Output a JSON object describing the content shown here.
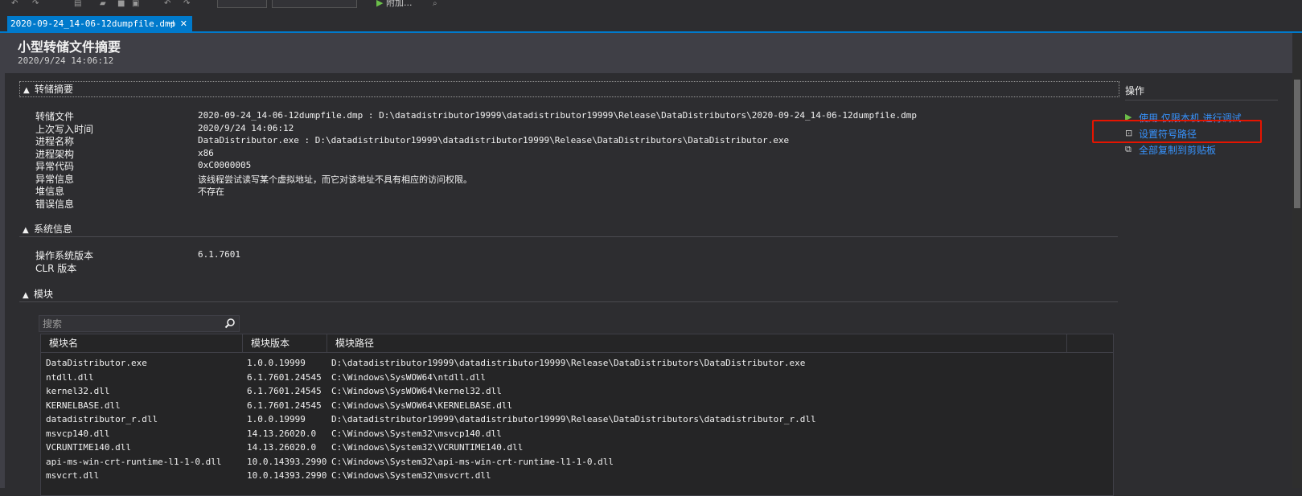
{
  "toolbar": {
    "attach_label": "附加..."
  },
  "tab": {
    "label": "2020-09-24_14-06-12dumpfile.dmp",
    "pin": "⊣",
    "close": "✕"
  },
  "header": {
    "title": "小型转储文件摘要",
    "subtitle": "2020/9/24 14:06:12"
  },
  "sections": {
    "dump_summary": "转储摘要",
    "system_info": "系统信息",
    "modules": "模块"
  },
  "dump_summary": [
    {
      "label": "转储文件",
      "value": "2020-09-24_14-06-12dumpfile.dmp : D:\\datadistributor19999\\datadistributor19999\\Release\\DataDistributors\\2020-09-24_14-06-12dumpfile.dmp"
    },
    {
      "label": "上次写入时间",
      "value": "2020/9/24 14:06:12"
    },
    {
      "label": "进程名称",
      "value": "DataDistributor.exe : D:\\datadistributor19999\\datadistributor19999\\Release\\DataDistributors\\DataDistributor.exe"
    },
    {
      "label": "进程架构",
      "value": "x86"
    },
    {
      "label": "异常代码",
      "value": "0xC0000005"
    },
    {
      "label": "异常信息",
      "value": "该线程尝试读写某个虚拟地址，而它对该地址不具有相应的访问权限。"
    },
    {
      "label": "堆信息",
      "value": "不存在"
    },
    {
      "label": "错误信息",
      "value": ""
    }
  ],
  "system_info": [
    {
      "label": "操作系统版本",
      "value": "6.1.7601"
    },
    {
      "label": "CLR 版本",
      "value": ""
    }
  ],
  "actions": {
    "title": "操作",
    "items": [
      {
        "label": "使用 仅限本机 进行调试",
        "icon": "play-icon"
      },
      {
        "label": "设置符号路径",
        "icon": "symbol-path-icon"
      },
      {
        "label": "全部复制到剪贴板",
        "icon": "copy-icon"
      }
    ]
  },
  "search": {
    "placeholder": "搜索"
  },
  "modules_table": {
    "columns": [
      "模块名",
      "模块版本",
      "模块路径"
    ],
    "rows": [
      [
        "DataDistributor.exe",
        "1.0.0.19999",
        "D:\\datadistributor19999\\datadistributor19999\\Release\\DataDistributors\\DataDistributor.exe"
      ],
      [
        "ntdll.dll",
        "6.1.7601.24545",
        "C:\\Windows\\SysWOW64\\ntdll.dll"
      ],
      [
        "kernel32.dll",
        "6.1.7601.24545",
        "C:\\Windows\\SysWOW64\\kernel32.dll"
      ],
      [
        "KERNELBASE.dll",
        "6.1.7601.24545",
        "C:\\Windows\\SysWOW64\\KERNELBASE.dll"
      ],
      [
        "datadistributor_r.dll",
        "1.0.0.19999",
        "D:\\datadistributor19999\\datadistributor19999\\Release\\DataDistributors\\datadistributor_r.dll"
      ],
      [
        "msvcp140.dll",
        "14.13.26020.0",
        "C:\\Windows\\System32\\msvcp140.dll"
      ],
      [
        "VCRUNTIME140.dll",
        "14.13.26020.0",
        "C:\\Windows\\System32\\VCRUNTIME140.dll"
      ],
      [
        "api-ms-win-crt-runtime-l1-1-0.dll",
        "10.0.14393.2990",
        "C:\\Windows\\System32\\api-ms-win-crt-runtime-l1-1-0.dll"
      ],
      [
        "msvcrt.dll",
        "10.0.14393.2990",
        "C:\\Windows\\System32\\msvcrt.dll"
      ]
    ]
  },
  "colors": {
    "accent": "#007acc",
    "link": "#3794ff",
    "highlight": "#e51400",
    "play": "#6bbf4a"
  }
}
